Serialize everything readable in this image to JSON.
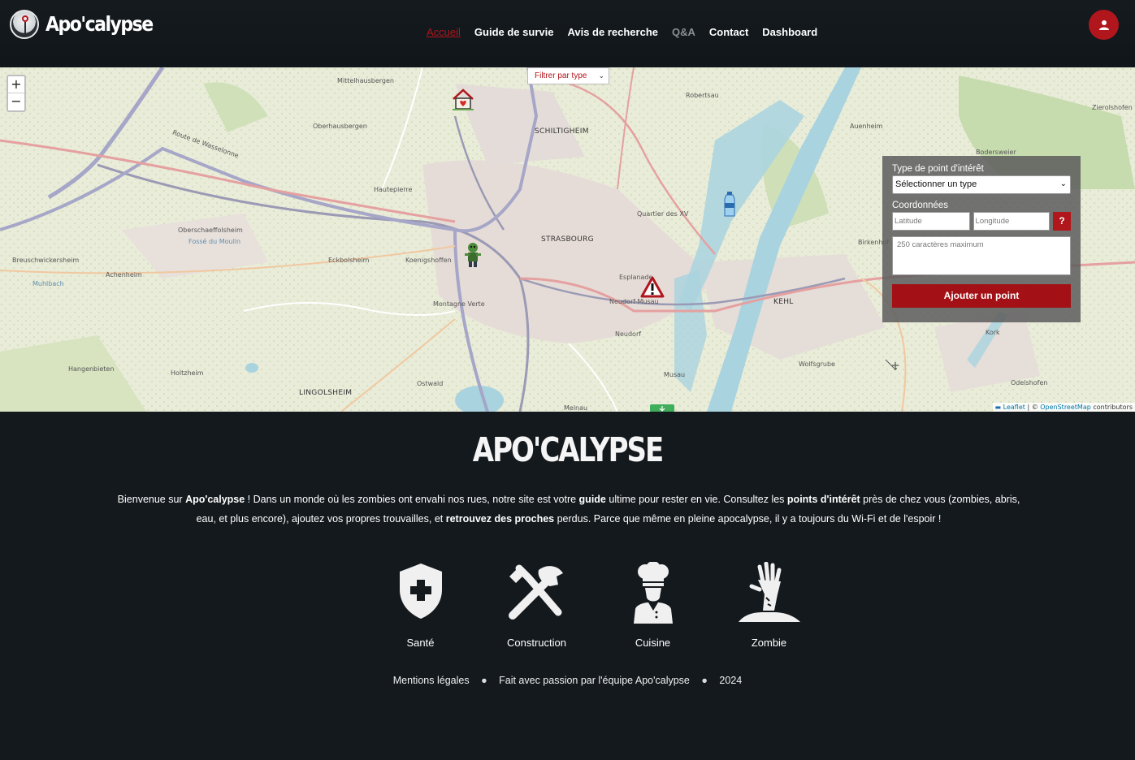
{
  "header": {
    "brand": "Apo'calypse",
    "nav": [
      {
        "label": "Accueil",
        "state": "active"
      },
      {
        "label": "Guide de survie",
        "state": "normal"
      },
      {
        "label": "Avis de recherche",
        "state": "normal"
      },
      {
        "label": "Q&A",
        "state": "muted"
      },
      {
        "label": "Contact",
        "state": "normal"
      },
      {
        "label": "Dashboard",
        "state": "normal"
      }
    ],
    "user_icon": "user-icon"
  },
  "map": {
    "filter_label": "Filtrer par type",
    "zoom_in": "+",
    "zoom_out": "−",
    "labels": {
      "schiltigheim": "SCHILTIGHEIM",
      "strasbourg": "STRASBOURG",
      "kehl": "KEHL",
      "lingolsheim": "LINGOLSHEIM",
      "hautepierre": "Hautepierre",
      "eckbolsheim": "Eckbolsheim",
      "koenigshoffen": "Koenigshoffen",
      "neudorf": "Neudorf",
      "robertsau": "Robertsau",
      "mittelhausbergen": "Mittelhausbergen",
      "oberhausbergen": "Oberhausbergen",
      "oberschaeffolsheim": "Oberschaeffolsheim",
      "breuschwickersheim": "Breuschwickersheim",
      "achenheim": "Achenheim",
      "holtzheim": "Holtzheim",
      "hangenbieten": "Hangenbieten",
      "ostwald": "Ostwald",
      "esplanade": "Esplanade",
      "montagne_verte": "Montagne Verte",
      "quartier_xv": "Quartier des XV",
      "musau": "Musau",
      "meinau": "Meinau",
      "kork": "Kork",
      "auenheim": "Auenheim",
      "zierolshofen": "Zierolshofen",
      "bodersweier": "Bodersweier",
      "birkenhof": "Birkenhof",
      "odelshofen": "Odelshofen",
      "wolfsgrube": "Wolfsgrube",
      "route_wasselonne": "Route de Wasselonne",
      "neudorf_musau": "Neudorf-Musau",
      "mulhbach": "Muhlbach",
      "fosse_moulin": "Fossé du Moulin"
    },
    "markers": {
      "house": "house-heart-icon",
      "water": "water-bottle-icon",
      "zombie": "zombie-icon",
      "warning": "warning-triangle-icon",
      "bottom": "green-marker-icon"
    },
    "attribution_leaflet": "Leaflet",
    "attribution_sep": " | © ",
    "attribution_osm": "OpenStreetMap",
    "attribution_rest": " contributors"
  },
  "poi_form": {
    "type_label": "Type de point d'intérêt",
    "type_selected": "Sélectionner un type",
    "coords_label": "Coordonnées",
    "latitude_placeholder": "Latitude",
    "longitude_placeholder": "Longitude",
    "help_label": "?",
    "description_placeholder": "250 caractères maximum",
    "submit_label": "Ajouter un point"
  },
  "intro": {
    "title": "APO'CALYPSE",
    "desc_1": "Bienvenue sur ",
    "desc_brand": "Apo'calypse",
    "desc_2": " ! Dans un monde où les zombies ont envahi nos rues, notre site est votre ",
    "desc_guide": "guide",
    "desc_3": " ultime pour rester en vie. Consultez les ",
    "desc_poi": "points d'intérêt",
    "desc_4": " près de chez vous (zombies, abris, eau, et plus encore), ajoutez vos propres trouvailles, et ",
    "desc_find": "retrouvez des proches",
    "desc_5": " perdus. Parce que même en pleine apocalypse, il y a toujours du Wi-Fi et de l'espoir !",
    "features": [
      {
        "label": "Santé",
        "icon": "health-shield-icon"
      },
      {
        "label": "Construction",
        "icon": "tools-icon"
      },
      {
        "label": "Cuisine",
        "icon": "chef-icon"
      },
      {
        "label": "Zombie",
        "icon": "zombie-hand-icon"
      }
    ]
  },
  "footer": {
    "legal": "Mentions légales",
    "made_by": "Fait avec passion par l'équipe Apo'calypse",
    "year": "2024"
  },
  "colors": {
    "accent": "#b0161c",
    "background": "#14191d",
    "panel": "#5c5c5c"
  }
}
